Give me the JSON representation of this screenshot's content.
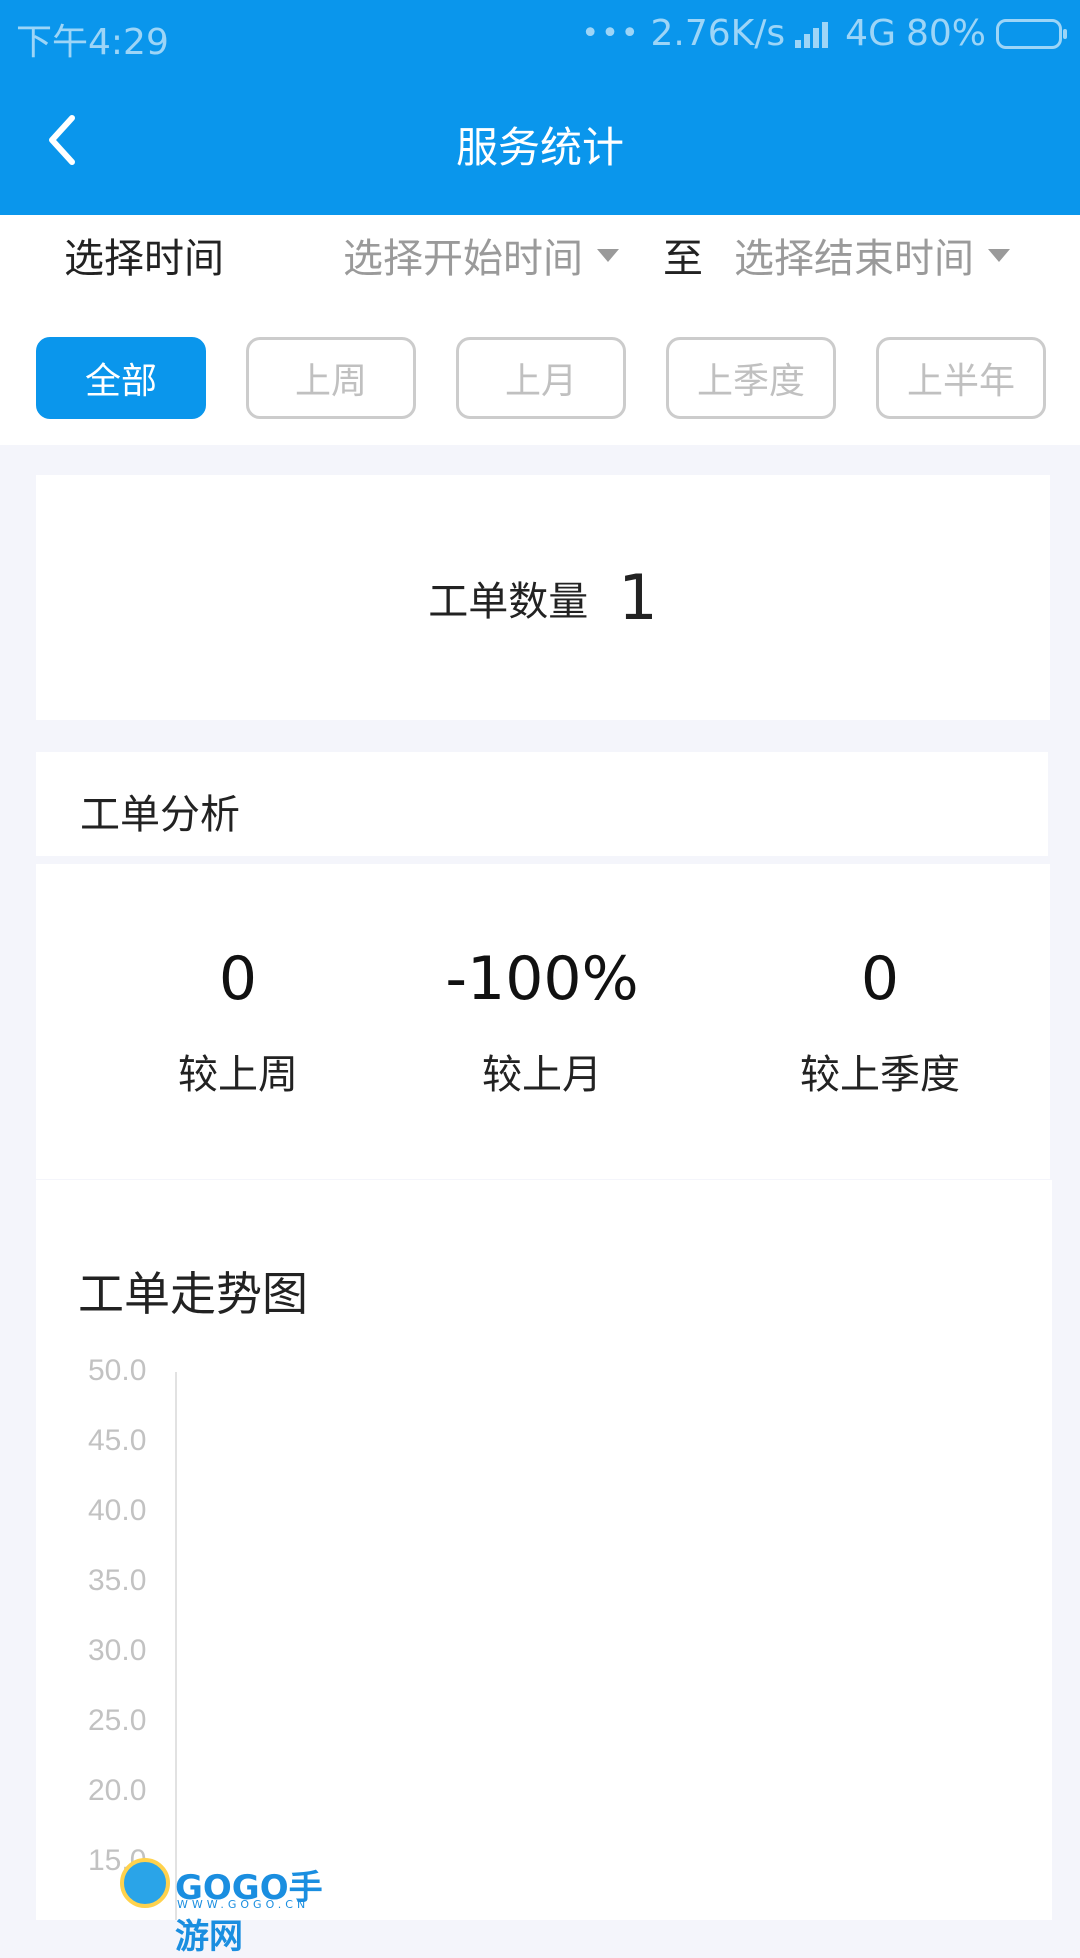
{
  "status_bar": {
    "time": "下午4:29",
    "speed": "2.76K/s",
    "network": "4G",
    "battery": "80%",
    "battery_level": 0.8
  },
  "header": {
    "title": "服务统计"
  },
  "filter": {
    "select_time_label": "选择时间",
    "start_placeholder": "选择开始时间",
    "to_label": "至",
    "end_placeholder": "选择结束时间",
    "chips": [
      "全部",
      "上周",
      "上月",
      "上季度",
      "上半年"
    ],
    "active_chip": "全部"
  },
  "summary": {
    "count_label": "工单数量",
    "count_value": "1"
  },
  "analysis": {
    "title": "工单分析",
    "stats": [
      {
        "value": "0",
        "label": "较上周"
      },
      {
        "value": "-100%",
        "label": "较上月"
      },
      {
        "value": "0",
        "label": "较上季度"
      }
    ]
  },
  "chart_section": {
    "title": "工单走势图"
  },
  "chart_data": {
    "type": "line",
    "title": "工单走势图",
    "y_ticks": [
      "50.0",
      "45.0",
      "40.0",
      "35.0",
      "30.0",
      "25.0",
      "20.0",
      "15.0"
    ],
    "ylim": [
      15,
      50
    ],
    "series": []
  },
  "colors": {
    "primary": "#0a96ec",
    "background": "#f4f5fb",
    "muted_text": "#9a9a9a"
  },
  "watermark": {
    "text": "GOGO手游网",
    "sub": "WWW.GOGO.CN"
  }
}
